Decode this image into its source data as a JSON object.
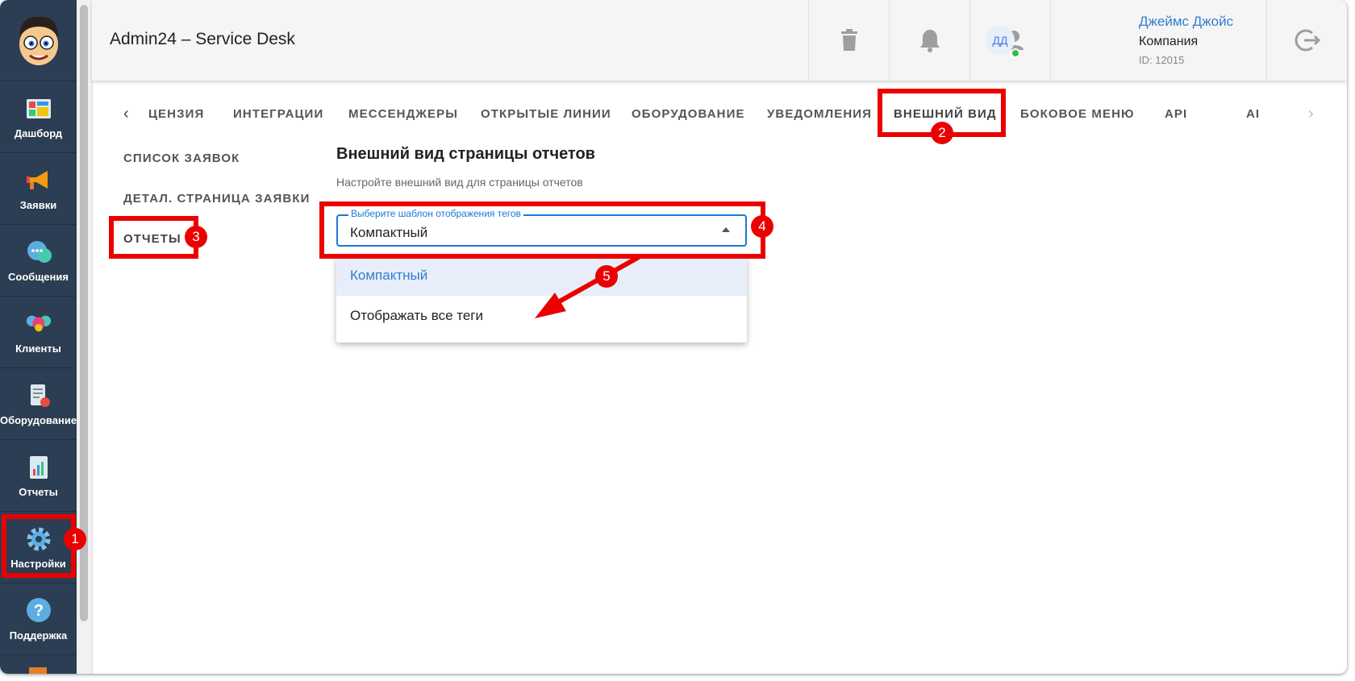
{
  "header": {
    "title": "Admin24 – Service Desk",
    "user_name": "Джеймс Джойс",
    "company": "Компания",
    "user_id": "ID: 12015",
    "avatar_initials": "ДД"
  },
  "sidebar": {
    "items": [
      {
        "label": "Дашборд",
        "icon": "dashboard-icon"
      },
      {
        "label": "Заявки",
        "icon": "megaphone-icon"
      },
      {
        "label": "Сообщения",
        "icon": "chat-icon"
      },
      {
        "label": "Клиенты",
        "icon": "clients-icon"
      },
      {
        "label": "Оборудование",
        "icon": "equipment-icon"
      },
      {
        "label": "Отчеты",
        "icon": "reports-icon"
      },
      {
        "label": "Настройки",
        "icon": "gear-icon"
      },
      {
        "label": "Поддержка",
        "icon": "help-icon"
      }
    ]
  },
  "tabs": [
    "ЦЕНЗИЯ",
    "ИНТЕГРАЦИИ",
    "МЕССЕНДЖЕРЫ",
    "ОТКРЫТЫЕ ЛИНИИ",
    "ОБОРУДОВАНИЕ",
    "УВЕДОМЛЕНИЯ",
    "ВНЕШНИЙ ВИД",
    "БОКОВОЕ МЕНЮ",
    "API",
    "AI"
  ],
  "subnav": [
    "СПИСОК ЗАЯВОК",
    "ДЕТАЛ. СТРАНИЦА ЗАЯВКИ",
    "ОТЧЕТЫ"
  ],
  "section": {
    "title": "Внешний вид страницы отчетов",
    "subtitle": "Настройте внешний вид для страницы отчетов",
    "select_label": "Выберите шаблон отображения тегов",
    "select_value": "Компактный",
    "options": [
      "Компактный",
      "Отображать все теги"
    ]
  },
  "annotations": [
    "1",
    "2",
    "3",
    "4",
    "5"
  ],
  "colors": {
    "sidebar_bg": "#2b3e53",
    "accent": "#1e77d3",
    "highlight": "#ea0000",
    "link": "#2f7fd1"
  }
}
